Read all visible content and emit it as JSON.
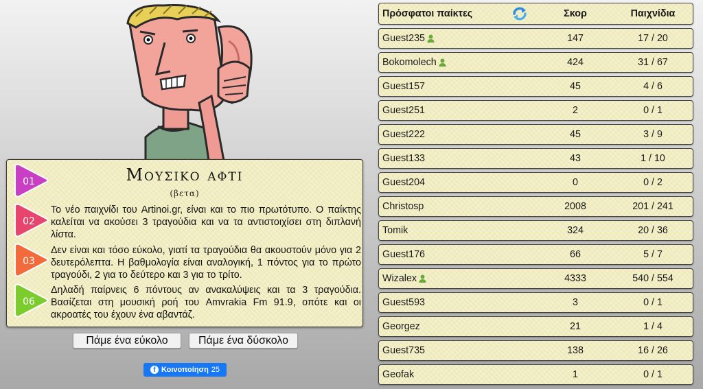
{
  "info": {
    "title": "Μουσικο αφτι",
    "subtitle": "(βετα)",
    "steps": [
      {
        "badge": "01",
        "color": "#c83fc4",
        "text": ""
      },
      {
        "badge": "02",
        "color": "#e8456e",
        "text": "Το νέο παιχνίδι του Artinoi.gr, είναι και το πιο πρωτότυπο. Ο παίκτης καλείται να ακούσει 3 τραγούδια και να τα αντιστοιχίσει στη διπλανή λίστα."
      },
      {
        "badge": "03",
        "color": "#f36b3b",
        "text": "Δεν είναι και τόσο εύκολο, γιατί τα τραγούδια θα ακουστούν μόνο για 2 δευτερόλεπτα. Η βαθμολογία είναι αναλογική, 1 πόντος για το πρώτο τραγούδι, 2 για το δεύτερο και 3 για το τρίτο."
      },
      {
        "badge": "06",
        "color": "#7dcc2e",
        "text": "Δηλαδή παίρνεις 6 πόντους αν ανακαλύψεις και τα 3 τραγούδια. Βασίζεται στη μουσική ροή του Amvrakia Fm 91.9, οπότε και οι ακροατές του έχουν ένα αβαντάζ."
      }
    ]
  },
  "buttons": {
    "easy": "Πάμε ένα εύκολο",
    "hard": "Πάμε ένα δύσκολο"
  },
  "share": {
    "label": "Κοινοποίηση",
    "count": "25"
  },
  "leaderboard": {
    "headers": {
      "player": "Πρόσφατοι παίκτες",
      "score": "Σκορ",
      "games": "Παιχνίδια"
    },
    "rows": [
      {
        "name": "Guest235",
        "registered": true,
        "score": "147",
        "games": "17 / 20"
      },
      {
        "name": "Bokomolech",
        "registered": true,
        "score": "424",
        "games": "31 / 67"
      },
      {
        "name": "Guest157",
        "registered": false,
        "score": "45",
        "games": "4 / 6"
      },
      {
        "name": "Guest251",
        "registered": false,
        "score": "2",
        "games": "0 / 1"
      },
      {
        "name": "Guest222",
        "registered": false,
        "score": "45",
        "games": "3 / 9"
      },
      {
        "name": "Guest133",
        "registered": false,
        "score": "43",
        "games": "1 / 10"
      },
      {
        "name": "Guest204",
        "registered": false,
        "score": "0",
        "games": "0 / 2"
      },
      {
        "name": "Christosp",
        "registered": false,
        "score": "2008",
        "games": "201 / 241"
      },
      {
        "name": "Tomik",
        "registered": false,
        "score": "324",
        "games": "20 / 36"
      },
      {
        "name": "Guest176",
        "registered": false,
        "score": "66",
        "games": "5 / 7"
      },
      {
        "name": "Wizalex",
        "registered": true,
        "score": "4333",
        "games": "540 / 554"
      },
      {
        "name": "Guest593",
        "registered": false,
        "score": "3",
        "games": "0 / 1"
      },
      {
        "name": "Georgez",
        "registered": false,
        "score": "21",
        "games": "1 / 4"
      },
      {
        "name": "Guest735",
        "registered": false,
        "score": "138",
        "games": "16 / 26"
      },
      {
        "name": "Geofak",
        "registered": false,
        "score": "1",
        "games": "0 / 1"
      }
    ]
  }
}
